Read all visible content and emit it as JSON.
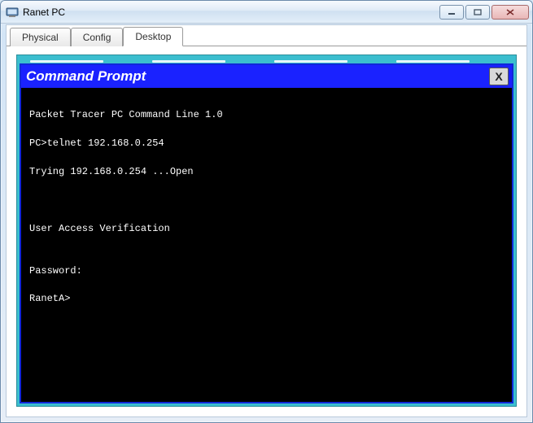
{
  "window": {
    "title": "Ranet PC"
  },
  "tabs": {
    "physical": "Physical",
    "config": "Config",
    "desktop": "Desktop"
  },
  "cmd": {
    "title": "Command Prompt",
    "close_label": "X"
  },
  "terminal": {
    "l1": "Packet Tracer PC Command Line 1.0",
    "l2": "PC>telnet 192.168.0.254",
    "l3": "Trying 192.168.0.254 ...Open",
    "l4": "",
    "l5": "",
    "l6": "User Access Verification",
    "l7": "",
    "l8": "Password:",
    "l9": "RanetA>"
  }
}
